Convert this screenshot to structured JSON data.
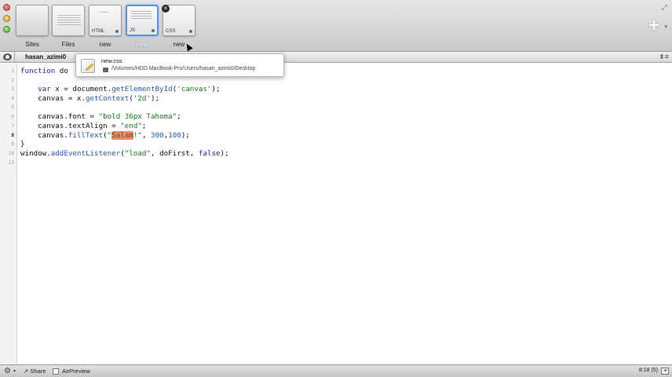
{
  "toolbar": {
    "items": [
      {
        "label": "Sites",
        "tag": ""
      },
      {
        "label": "Files",
        "tag": ""
      },
      {
        "label": "new",
        "tag": "HTML"
      },
      {
        "label": "new",
        "tag": "JS"
      },
      {
        "label": "new",
        "tag": "CSS"
      }
    ],
    "selected_index": 3,
    "close_glyph": "×",
    "plus_glyph": "+"
  },
  "pathbar": {
    "site_name": "hasan_azimi0",
    "menu_glyph": "⇟≡"
  },
  "tooltip": {
    "file_name": "new.css",
    "file_path": "/Volumes/HDD MacBook-Pro/Users/hasan_azimi0/Desktop"
  },
  "editor": {
    "current_line": 8,
    "line_numbers": [
      "1",
      "2",
      "3",
      "4",
      "5",
      "6",
      "7",
      "8",
      "9",
      "10",
      "11"
    ]
  },
  "statusbar": {
    "share_label": "Share",
    "airpreview_label": "AirPreview",
    "position": "8:18 (5)"
  }
}
